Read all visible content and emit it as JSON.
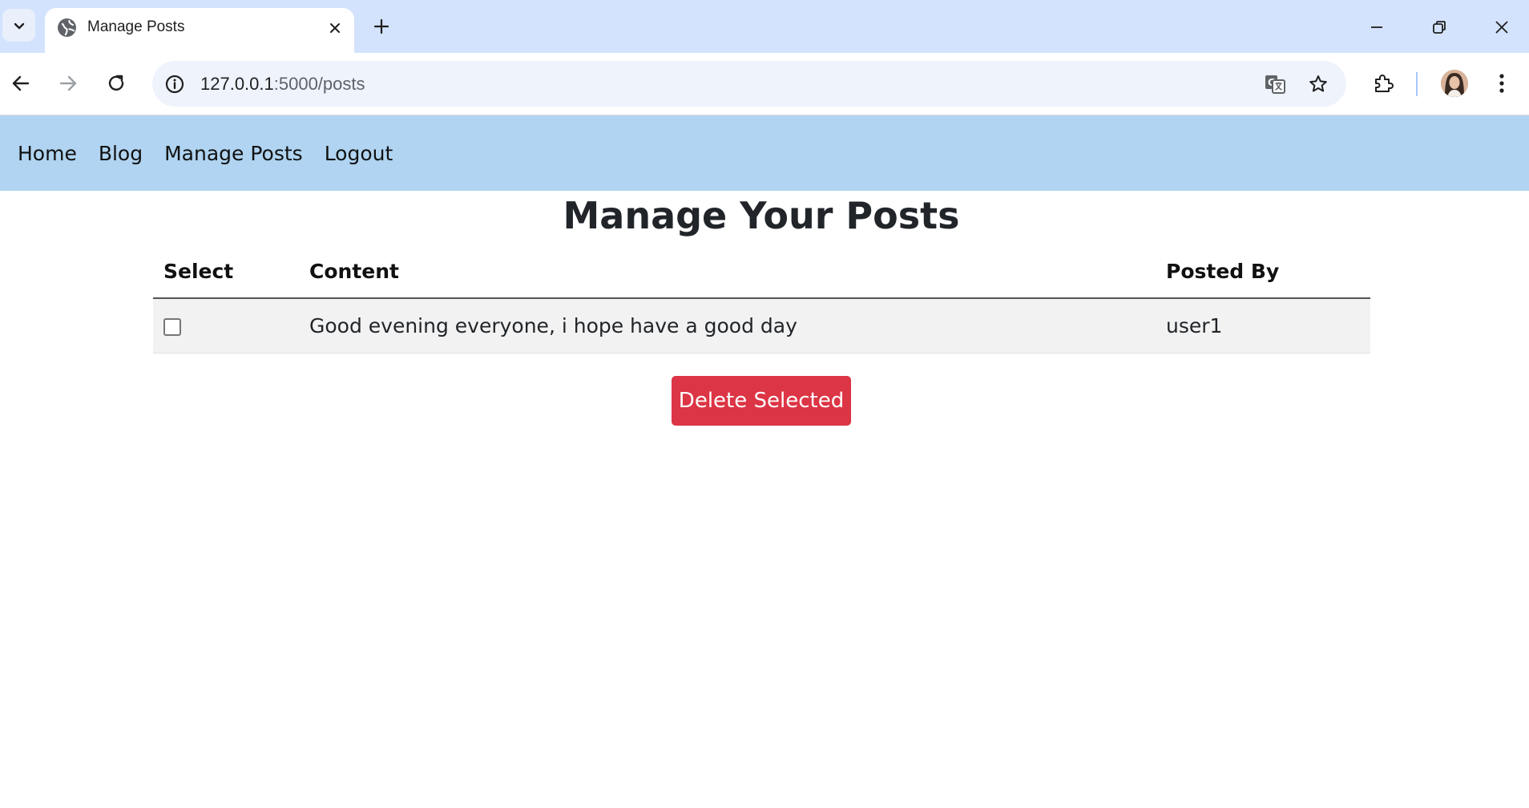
{
  "browser": {
    "tab": {
      "title": "Manage Posts"
    },
    "address_bar": {
      "url_host": "127.0.0.1",
      "url_path": ":5000/posts"
    },
    "icons": [
      "tab-search-icon",
      "globe-icon",
      "close-icon",
      "plus-icon",
      "minimize-icon",
      "restore-icon",
      "window-close-icon",
      "back-arrow-icon",
      "forward-arrow-icon",
      "reload-icon",
      "site-info-icon",
      "translate-icon",
      "star-icon",
      "extensions-icon",
      "avatar",
      "kebab-menu-icon"
    ]
  },
  "site_nav": {
    "items": [
      {
        "label": "Home"
      },
      {
        "label": "Blog"
      },
      {
        "label": "Manage Posts"
      },
      {
        "label": "Logout"
      }
    ]
  },
  "main": {
    "title": "Manage Your Posts",
    "table": {
      "headers": {
        "select": "Select",
        "content": "Content",
        "posted_by": "Posted By"
      },
      "rows": [
        {
          "checked": false,
          "content": "Good evening everyone, i hope have a good day",
          "posted_by": "user1"
        }
      ]
    },
    "delete_button": {
      "label": "Delete Selected",
      "color": "#dc3545"
    }
  },
  "colors": {
    "nav_bg": "#b0d4f1",
    "tabstrip_bg": "#d3e3fd",
    "row_bg": "#f2f2f2"
  }
}
